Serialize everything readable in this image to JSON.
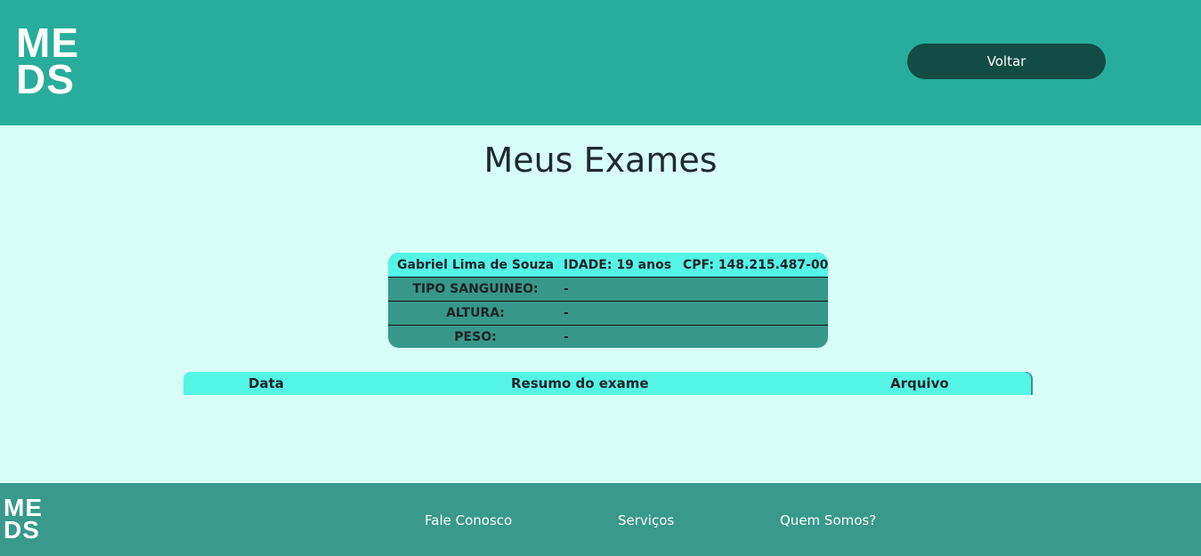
{
  "header": {
    "logo_line1": "ME",
    "logo_line2": "DS",
    "back_label": "Voltar"
  },
  "page_title": "Meus Exames",
  "patient": {
    "name": "Gabriel Lima de Souza",
    "age": "IDADE: 19 anos",
    "cpf": "CPF: 148.215.487-00",
    "rows": [
      {
        "label": "TIPO SANGUINEO:",
        "value": "-"
      },
      {
        "label": "ALTURA:",
        "value": "-"
      },
      {
        "label": "PESO:",
        "value": "-"
      }
    ]
  },
  "exams_table": {
    "columns": [
      "Data",
      "Resumo do exame",
      "Arquivo"
    ]
  },
  "footer": {
    "logo_line1": "ME",
    "logo_line2": "DS",
    "links": [
      "Fale Conosco",
      "Serviços",
      "Quem Somos?"
    ]
  },
  "colors": {
    "header_bg": "#28ad9c",
    "page_bg": "#d7fff8",
    "button_bg": "#124c45",
    "table_head_bg": "#55f5e6",
    "table_body_bg": "#38978b",
    "footer_bg": "#38998c"
  }
}
